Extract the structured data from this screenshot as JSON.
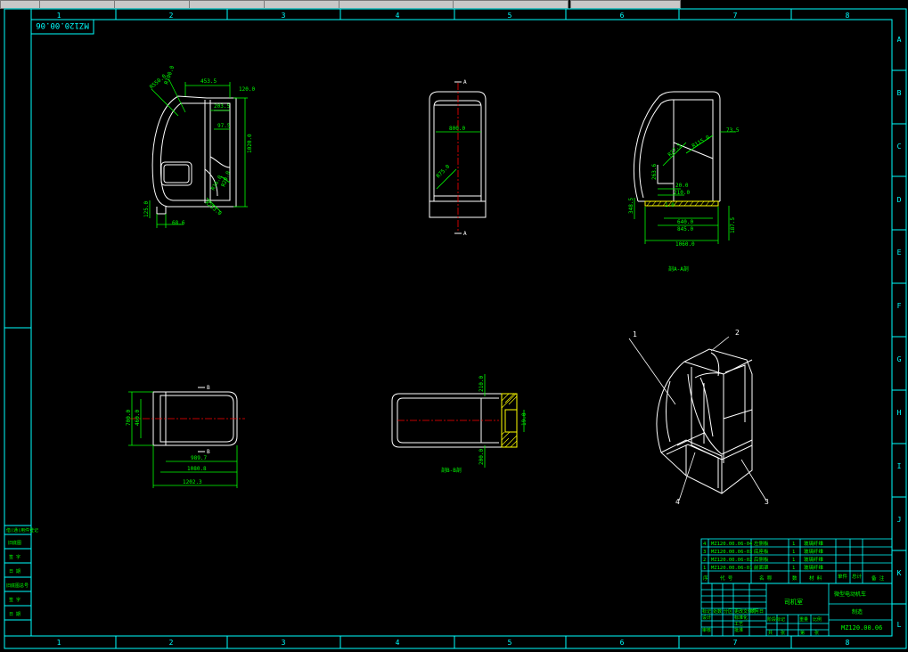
{
  "sheet": {
    "drawing_number": "MZ120.00.06",
    "drawing_number_upside_down": "MZ120.00.06",
    "column_numbers": [
      "1",
      "2",
      "3",
      "4",
      "5",
      "6",
      "7",
      "8"
    ],
    "row_letters": [
      "A",
      "B",
      "C",
      "D",
      "E",
      "F",
      "G",
      "H",
      "I",
      "J",
      "K",
      "L"
    ]
  },
  "views": {
    "front": {
      "dims": [
        "453.5",
        "R550.0",
        "R100.0",
        "R",
        "203.5",
        "120.0",
        "97.5",
        "1020.0",
        "R16.0",
        "R20.0",
        "R253.0",
        "125.0",
        "68.6"
      ]
    },
    "side": {
      "section_mark_top": "A",
      "section_mark_bottom": "A",
      "dims": [
        "800.0",
        "R75.0"
      ]
    },
    "section_aa": {
      "title": "剖A-A剖",
      "dims": [
        "73.5",
        "R115.0",
        "R27.5",
        "263.6",
        "20.0",
        "210.0",
        "348.5",
        "1.0",
        "640.0",
        "845.0",
        "1060.0",
        "187.5"
      ]
    },
    "top": {
      "section_mark_top": "B",
      "section_mark_bottom": "B",
      "dims": [
        "700.0",
        "460.0",
        "989.7",
        "1080.8",
        "1202.3"
      ]
    },
    "section_bb": {
      "title": "剖B-B剖",
      "dims": [
        "210.0",
        "19.0",
        "200.0"
      ]
    },
    "isometric": {
      "balloons": [
        "1",
        "2",
        "3",
        "4"
      ]
    }
  },
  "left_stamp": {
    "rows": [
      "借(通)用件登记",
      "旧底图",
      "签 字",
      "日 期",
      "旧底图总号",
      "签 字",
      "日 期"
    ]
  },
  "bom": {
    "rows": [
      {
        "no": "4",
        "code": "MZ120.00.06-04",
        "name": "左侧板",
        "qty": "1",
        "material": "玻璃纤维"
      },
      {
        "no": "3",
        "code": "MZ120.00.06-03",
        "name": "底座板",
        "qty": "1",
        "material": "玻璃纤维"
      },
      {
        "no": "2",
        "code": "MZ120.00.06-02",
        "name": "后侧板",
        "qty": "1",
        "material": "玻璃纤维"
      },
      {
        "no": "1",
        "code": "MZ120.00.06-01",
        "name": "前面罩",
        "qty": "1",
        "material": "玻璃纤维"
      }
    ],
    "header": [
      "序",
      "代 号",
      "名 称",
      "数",
      "材 料",
      "单件",
      "总计",
      "备 注"
    ]
  },
  "title_block": {
    "part_name": "司机室",
    "project": "微型电动机车",
    "unit": "制造",
    "drawing_number": "MZ120.00.06",
    "scale_labels": [
      "阶段标记",
      "重量",
      "比例"
    ],
    "sheet_labels": [
      "共",
      "张",
      "第",
      "张"
    ],
    "cells": [
      "标记",
      "处数",
      "分区",
      "更改文件号",
      "签名",
      "年月日",
      "设计",
      "标准化",
      "审核",
      "工艺",
      "批准"
    ]
  },
  "colors": {
    "background": "#000000",
    "border": "#00ffff",
    "geometry": "#ffffff",
    "dimension": "#00ff00",
    "centerline": "#ff0000",
    "hatch": "#ffff00",
    "text_green": "#00ff00"
  }
}
